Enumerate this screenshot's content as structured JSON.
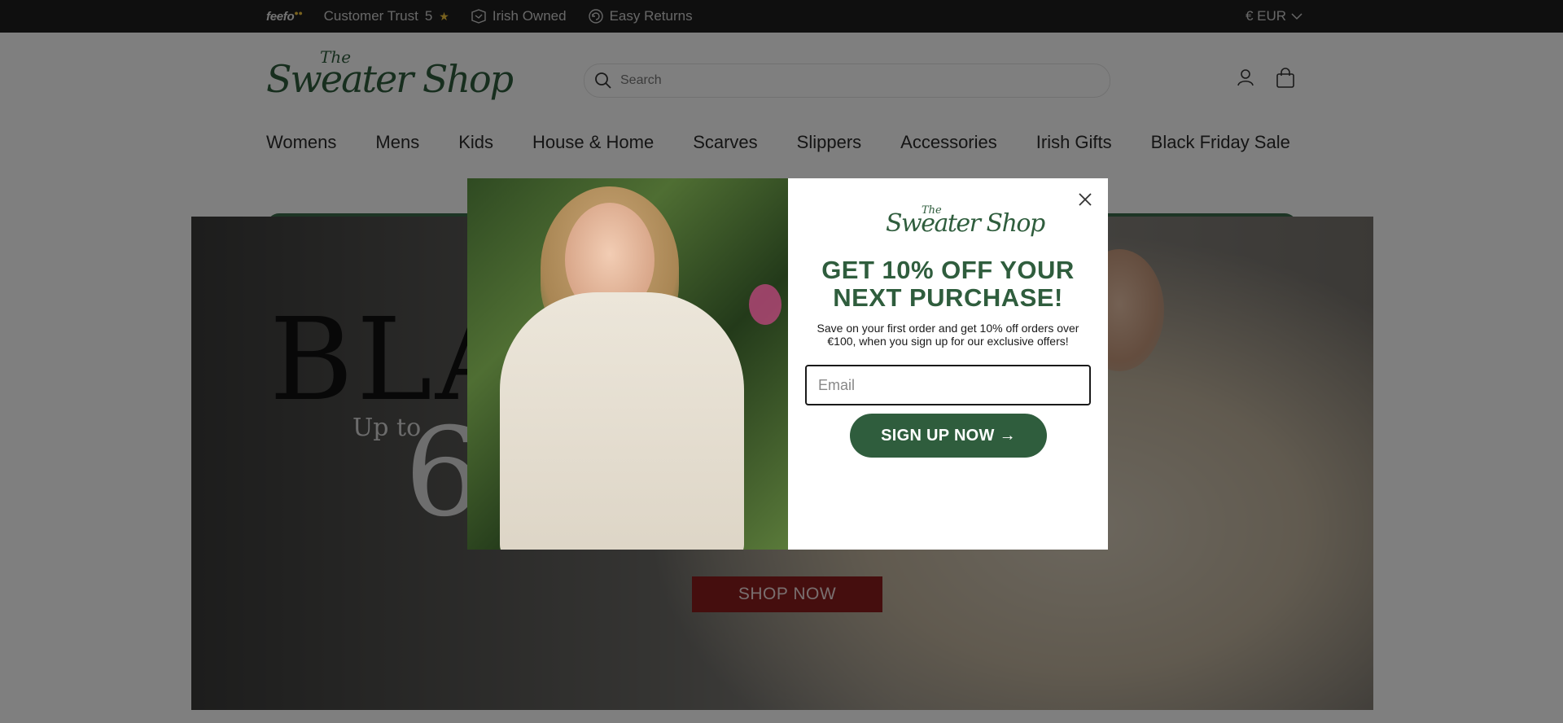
{
  "topbar": {
    "feefo_logo": "feefo",
    "trust_label": "Customer Trust",
    "trust_score": "5",
    "star": "★",
    "irish_owned": "Irish Owned",
    "easy_returns": "Easy Returns",
    "currency": "€ EUR"
  },
  "header": {
    "logo_the": "The",
    "logo_main": "Sweater Shop",
    "search_placeholder": "Search"
  },
  "nav": {
    "items": [
      "Womens",
      "Mens",
      "Kids",
      "House & Home",
      "Scarves",
      "Slippers",
      "Accessories",
      "Irish Gifts",
      "Black Friday Sale"
    ]
  },
  "hero": {
    "headline_partial": "BLAC",
    "upto": "Up to",
    "big_number": "6",
    "cta": "SHOP NOW"
  },
  "modal": {
    "logo_the": "The",
    "logo_main": "Sweater Shop",
    "headline": "GET 10% OFF YOUR NEXT PURCHASE!",
    "subtext": "Save on your first order and get 10% off orders over €100, when you sign up for our exclusive offers!",
    "email_placeholder": "Email",
    "signup_label": "SIGN UP NOW →"
  },
  "colors": {
    "brand_green": "#2f5d3d",
    "cta_red": "#8a1c1c",
    "topbar_bg": "#1f1f1f"
  },
  "icons": [
    "feefo-logo",
    "irish-owned-icon",
    "easy-returns-icon",
    "chevron-down-icon",
    "search-icon",
    "account-icon",
    "bag-icon",
    "close-icon"
  ]
}
